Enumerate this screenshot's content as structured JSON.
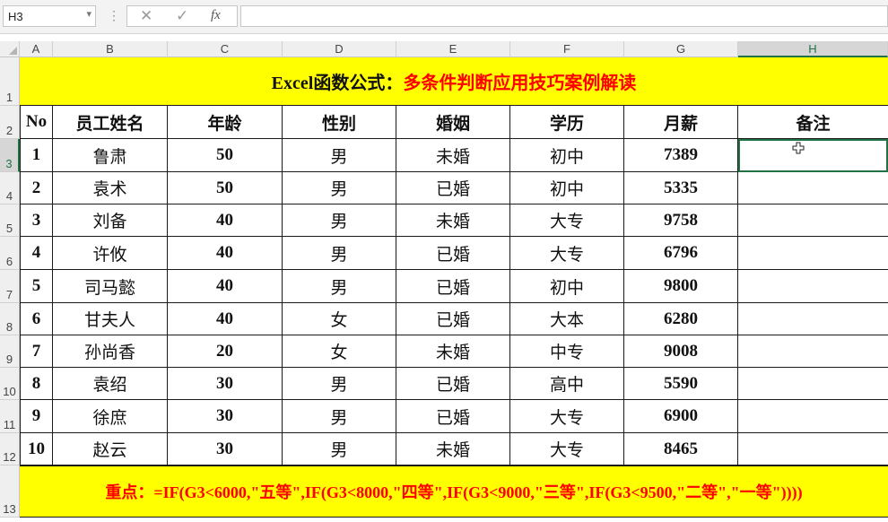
{
  "formula_bar": {
    "name_box": "H3",
    "dropdown_icon": "chevron-down-icon",
    "cancel_glyph": "✕",
    "enter_glyph": "✓",
    "fx_label": "fx",
    "formula_value": ""
  },
  "columns": [
    "A",
    "B",
    "C",
    "D",
    "E",
    "F",
    "G",
    "H"
  ],
  "selected_column": "H",
  "rows": [
    "1",
    "2",
    "3",
    "4",
    "5",
    "6",
    "7",
    "8",
    "9",
    "10",
    "11",
    "12",
    "13"
  ],
  "selected_row": "3",
  "title": {
    "part1": "Excel函数公式：",
    "part2": "多条件判断应用技巧案例解读"
  },
  "headers": [
    "No",
    "员工姓名",
    "年龄",
    "性别",
    "婚姻",
    "学历",
    "月薪",
    "备注"
  ],
  "records": [
    [
      "1",
      "鲁肃",
      "50",
      "男",
      "未婚",
      "初中",
      "7389",
      ""
    ],
    [
      "2",
      "袁术",
      "50",
      "男",
      "已婚",
      "初中",
      "5335",
      ""
    ],
    [
      "3",
      "刘备",
      "40",
      "男",
      "未婚",
      "大专",
      "9758",
      ""
    ],
    [
      "4",
      "许攸",
      "40",
      "男",
      "已婚",
      "大专",
      "6796",
      ""
    ],
    [
      "5",
      "司马懿",
      "40",
      "男",
      "已婚",
      "初中",
      "9800",
      ""
    ],
    [
      "6",
      "甘夫人",
      "40",
      "女",
      "已婚",
      "大本",
      "6280",
      ""
    ],
    [
      "7",
      "孙尚香",
      "20",
      "女",
      "未婚",
      "中专",
      "9008",
      ""
    ],
    [
      "8",
      "袁绍",
      "30",
      "男",
      "已婚",
      "高中",
      "5590",
      ""
    ],
    [
      "9",
      "徐庶",
      "30",
      "男",
      "已婚",
      "大专",
      "6900",
      ""
    ],
    [
      "10",
      "赵云",
      "30",
      "男",
      "未婚",
      "大专",
      "8465",
      ""
    ]
  ],
  "note": "重点：=IF(G3<6000,\"五等\",IF(G3<8000,\"四等\",IF(G3<9000,\"三等\",IF(G3<9500,\"二等\",\"一等\"))))",
  "colors": {
    "highlight": "#ffff00",
    "accent_red": "#ff0000",
    "selection": "#217346"
  }
}
